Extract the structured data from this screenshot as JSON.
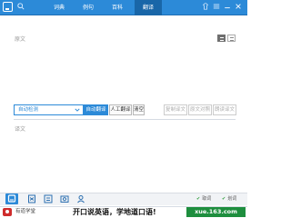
{
  "header": {
    "tabs": [
      {
        "label": "词典",
        "active": false
      },
      {
        "label": "例句",
        "active": false
      },
      {
        "label": "百科",
        "active": false
      },
      {
        "label": "翻译",
        "active": true
      }
    ],
    "icons": [
      "app-logo-icon",
      "search-icon",
      "skin-icon",
      "menu-icon",
      "minimize-icon",
      "close-icon"
    ]
  },
  "source": {
    "placeholder": "原文"
  },
  "toolbar": {
    "language_value": "自动检测",
    "auto_translate_label": "自动翻译",
    "human_translate_label": "人工翻译",
    "clear_label": "清空",
    "copy_translation_label": "复制译文",
    "original_comparison_label": "原文对照",
    "read_translation_label": "朗读译文"
  },
  "target": {
    "placeholder": "译文"
  },
  "footer": {
    "nav_icons": [
      "home-icon",
      "wordbook-icon",
      "screen-translate-icon",
      "photo-translate-icon",
      "user-icon"
    ],
    "status_1": "取词",
    "status_2": "划词"
  },
  "ad": {
    "brand": "有道学堂",
    "slogan": "开口说英语，学地道口语!",
    "site": "xue.163.com"
  },
  "colors": {
    "accent": "#2c8ad8",
    "active_tab": "#1966a8",
    "ad_green": "#1e8e3e"
  }
}
